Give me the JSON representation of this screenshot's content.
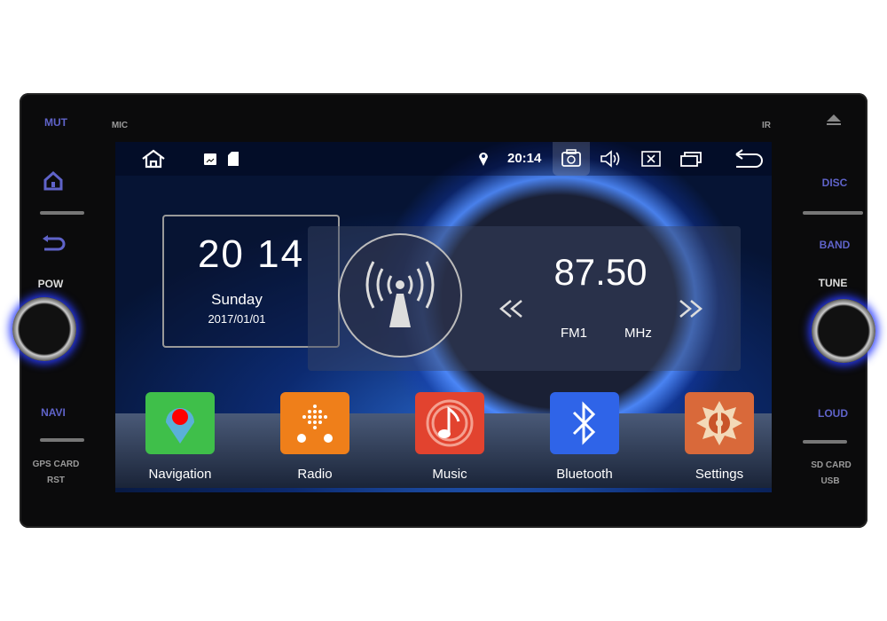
{
  "hardware": {
    "left": {
      "mute": "MUT",
      "pow": "POW",
      "navi": "NAVI",
      "gps_card": "GPS CARD",
      "rst": "RST",
      "mic": "MIC"
    },
    "right": {
      "disc": "DISC",
      "band": "BAND",
      "tune": "TUNE",
      "loud": "LOUD",
      "sd_card": "SD CARD",
      "usb": "USB",
      "ir": "IR"
    },
    "accent": "#5f63c9"
  },
  "status_bar": {
    "time": "20:14",
    "icons": [
      "home-icon",
      "gallery-icon",
      "sd-card-icon",
      "location-icon",
      "camera-icon",
      "volume-icon",
      "close-box-icon",
      "recents-icon",
      "back-icon"
    ]
  },
  "clock_widget": {
    "time": "20 14",
    "day": "Sunday",
    "date": "2017/01/01"
  },
  "radio_widget": {
    "frequency": "87.50",
    "band": "FM1",
    "unit": "MHz"
  },
  "apps": [
    {
      "label": "Navigation",
      "color": "#3fbf4a",
      "icon": "map-pin-icon"
    },
    {
      "label": "Radio",
      "color": "#ef7f1a",
      "icon": "radio-icon"
    },
    {
      "label": "Music",
      "color": "#e2432f",
      "icon": "music-note-icon"
    },
    {
      "label": "Bluetooth",
      "color": "#2f64e8",
      "icon": "bluetooth-icon"
    },
    {
      "label": "Settings",
      "color": "#d9693a",
      "icon": "settings-icon"
    }
  ]
}
